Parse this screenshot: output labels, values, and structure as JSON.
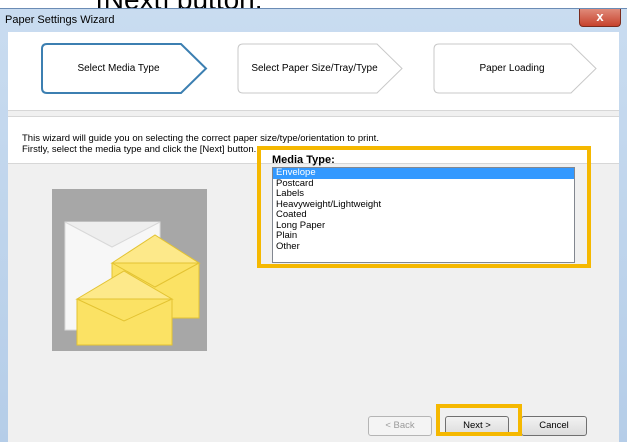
{
  "caption": {
    "text": "[Next] button."
  },
  "window": {
    "title": "Paper Settings Wizard",
    "close_glyph": "x"
  },
  "steps": [
    {
      "label": "Select Media Type",
      "active": true
    },
    {
      "label": "Select Paper Size/Tray/Type",
      "active": false
    },
    {
      "label": "Paper Loading",
      "active": false
    }
  ],
  "info": {
    "line1": "This wizard will guide you on selecting the correct paper size/type/orientation to print.",
    "line2": "Firstly, select the media type and click the [Next] button."
  },
  "media_type": {
    "label": "Media Type:",
    "options": [
      "Envelope",
      "Postcard",
      "Labels",
      "Heavyweight/Lightweight",
      "Coated",
      "Long Paper",
      "Plain",
      "Other"
    ],
    "selected": "Envelope"
  },
  "buttons": {
    "back": "< Back",
    "next": "Next >",
    "cancel": "Cancel"
  },
  "colors": {
    "highlight": "#f5b800",
    "selection": "#3399ff",
    "active_step_border": "#3c7fb1"
  }
}
